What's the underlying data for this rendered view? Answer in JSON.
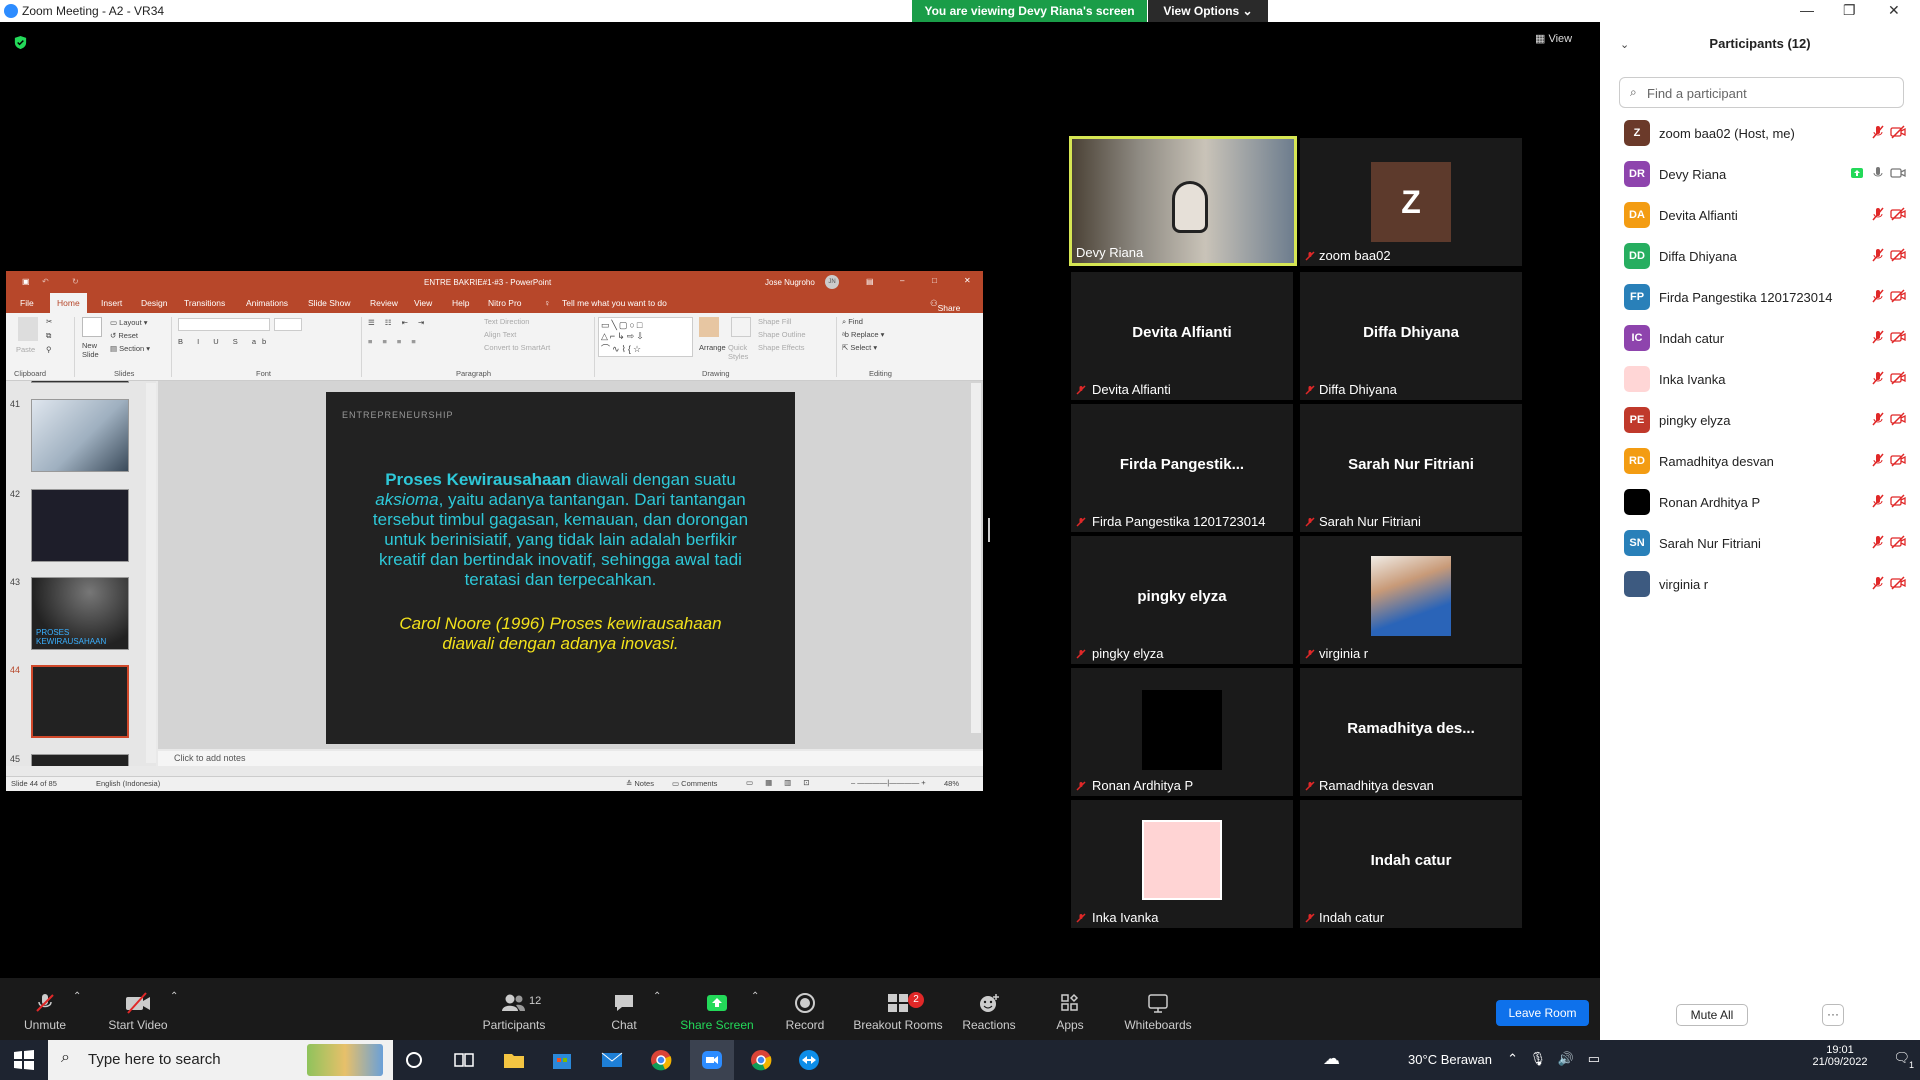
{
  "window": {
    "title": "Zoom Meeting - A2 - VR34"
  },
  "share_banner": {
    "text": "You are viewing Devy Riana's screen",
    "view_options": "View Options"
  },
  "view_button": "View",
  "ppt": {
    "title": "ENTRE BAKRIE#1-#3  -  PowerPoint",
    "user": "Jose Nugroho",
    "user_initials": "JN",
    "tabs": [
      "File",
      "Home",
      "Insert",
      "Design",
      "Transitions",
      "Animations",
      "Slide Show",
      "Review",
      "View",
      "Help",
      "Nitro Pro"
    ],
    "tell_me": "Tell me what you want to do",
    "share": "Share",
    "ribbon": {
      "paste": "Paste",
      "new_slide": "New Slide",
      "layout": "Layout",
      "reset": "Reset",
      "section": "Section",
      "text_direction": "Text Direction",
      "align_text": "Align Text",
      "convert_smartart": "Convert to SmartArt",
      "arrange": "Arrange",
      "quick_styles": "Quick Styles",
      "shape_fill": "Shape Fill",
      "shape_outline": "Shape Outline",
      "shape_effects": "Shape Effects",
      "find": "Find",
      "replace": "Replace",
      "select": "Select",
      "groups": [
        "Clipboard",
        "Slides",
        "Font",
        "Paragraph",
        "Drawing",
        "Editing"
      ]
    },
    "thumb_numbers": [
      "41",
      "42",
      "43",
      "44",
      "45"
    ],
    "thumb43_text": "PROSES KEWIRAUSAHAAN",
    "slide": {
      "header": "ENTREPRENEURSHIP",
      "bold_lead": "Proses Kewirausahaan",
      "part1": " diawali dengan suatu ",
      "italic_word": "aksioma",
      "part2": ", yaitu adanya tantangan. Dari tantangan tersebut timbul gagasan, kemauan, dan dorongan untuk berinisiatif, yang tidak lain adalah berfikir kreatif dan bertindak inovatif, sehingga awal tadi teratasi dan terpecahkan.",
      "quote": "Carol Noore (1996) Proses kewirausahaan diawali dengan adanya inovasi."
    },
    "notes": "Click to add notes",
    "status": {
      "slide": "Slide 44 of 85",
      "language": "English (Indonesia)",
      "notes": "Notes",
      "comments": "Comments",
      "zoom": "48%"
    }
  },
  "tiles": [
    {
      "label": "Devy Riana",
      "big": ""
    },
    {
      "label": "zoom baa02",
      "big": "Z"
    },
    {
      "label": "Devita Alfianti",
      "big": "Devita Alfianti"
    },
    {
      "label": "Diffa Dhiyana",
      "big": "Diffa Dhiyana"
    },
    {
      "label": "Firda Pangestika 1201723014",
      "big": "Firda  Pangestik..."
    },
    {
      "label": "Sarah Nur Fitriani",
      "big": "Sarah Nur Fitriani"
    },
    {
      "label": "pingky elyza",
      "big": "pingky elyza"
    },
    {
      "label": "virginia r",
      "big": ""
    },
    {
      "label": "Ronan Ardhitya P",
      "big": ""
    },
    {
      "label": "Ramadhitya desvan",
      "big": "Ramadhitya  des..."
    },
    {
      "label": "Inka Ivanka",
      "big": ""
    },
    {
      "label": "Indah catur",
      "big": "Indah catur"
    }
  ],
  "panel": {
    "title": "Participants (12)",
    "search_placeholder": "Find a participant",
    "participants": [
      {
        "initials": "Z",
        "name": "zoom baa02 (Host, me)",
        "color": "#6b3a2a"
      },
      {
        "initials": "DR",
        "name": "Devy Riana",
        "color": "#8e44ad"
      },
      {
        "initials": "DA",
        "name": "Devita Alfianti",
        "color": "#f39c12"
      },
      {
        "initials": "DD",
        "name": "Diffa Dhiyana",
        "color": "#27ae60"
      },
      {
        "initials": "FP",
        "name": "Firda Pangestika 1201723014",
        "color": "#2980b9"
      },
      {
        "initials": "IC",
        "name": "Indah catur",
        "color": "#8e44ad"
      },
      {
        "initials": "",
        "name": "Inka Ivanka",
        "color": "#ffd6d6"
      },
      {
        "initials": "PE",
        "name": "pingky elyza",
        "color": "#c0392b"
      },
      {
        "initials": "RD",
        "name": "Ramadhitya desvan",
        "color": "#f39c12"
      },
      {
        "initials": "",
        "name": "Ronan Ardhitya P",
        "color": "#000000"
      },
      {
        "initials": "SN",
        "name": "Sarah Nur Fitriani",
        "color": "#2980b9"
      },
      {
        "initials": "",
        "name": "virginia r",
        "color": "#3d5a80"
      }
    ],
    "mute_all": "Mute All",
    "more": "···"
  },
  "toolbar": {
    "unmute": "Unmute",
    "start_video": "Start Video",
    "participants": "Participants",
    "participants_count": "12",
    "chat": "Chat",
    "share_screen": "Share Screen",
    "record": "Record",
    "breakout": "Breakout Rooms",
    "breakout_badge": "2",
    "reactions": "Reactions",
    "apps": "Apps",
    "whiteboards": "Whiteboards",
    "leave": "Leave Room"
  },
  "taskbar": {
    "search": "Type here to search",
    "weather": "30°C  Berawan",
    "time": "19:01",
    "date": "21/09/2022",
    "notif_count": "1"
  }
}
